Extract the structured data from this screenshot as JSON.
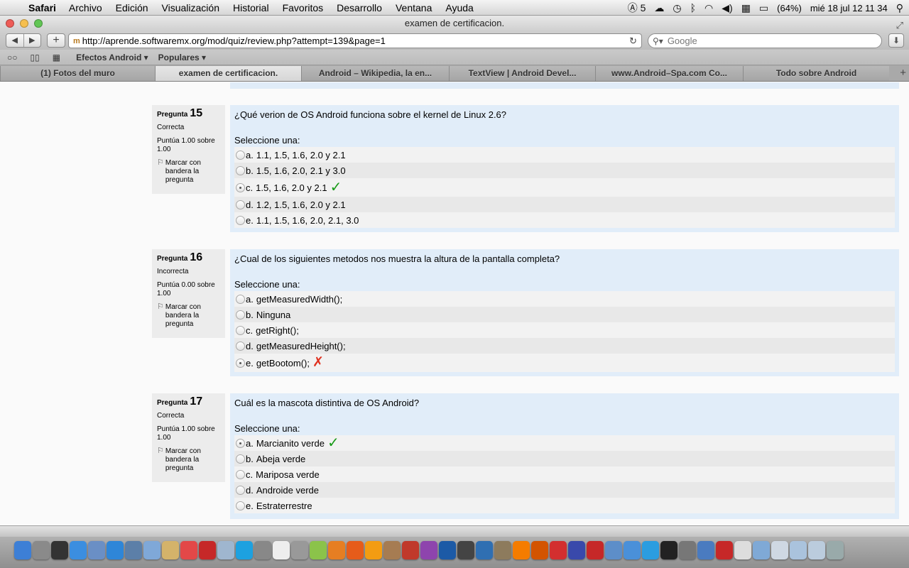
{
  "menubar": {
    "app": "Safari",
    "items": [
      "Archivo",
      "Edición",
      "Visualización",
      "Historial",
      "Favoritos",
      "Desarrollo",
      "Ventana",
      "Ayuda"
    ],
    "adobe_count": "5",
    "battery": "(64%)",
    "clock": "mié 18 jul  12 11 34"
  },
  "window": {
    "title": "examen de certificacion."
  },
  "toolbar": {
    "url": "http://aprende.softwaremx.org/mod/quiz/review.php?attempt=139&page=1",
    "search_placeholder": "Google"
  },
  "bookmarks": [
    "Efectos Android ▾",
    "Populares ▾"
  ],
  "tabs": [
    "(1) Fotos del muro",
    "examen de certificacion.",
    "Android – Wikipedia, la en...",
    "TextView | Android Devel...",
    "www.Android–Spa.com Co...",
    "Todo sobre Android"
  ],
  "questions": [
    {
      "label": "Pregunta",
      "number": "15",
      "state": "Correcta",
      "grade": "Puntúa 1.00 sobre 1.00",
      "flag": "Marcar con bandera la pregunta",
      "text": "¿Qué verion de OS Android funciona sobre el kernel de Linux 2.6?",
      "prompt": "Seleccione una:",
      "answers": [
        {
          "letter": "a.",
          "text": "1.1, 1.5, 1.6, 2.0 y 2.1"
        },
        {
          "letter": "b.",
          "text": "1.5, 1.6, 2.0, 2.1 y 3.0"
        },
        {
          "letter": "c.",
          "text": "1.5, 1.6, 2.0 y 2.1"
        },
        {
          "letter": "d.",
          "text": "1.2, 1.5, 1.6, 2.0 y 2.1"
        },
        {
          "letter": "e.",
          "text": "1.1, 1.5, 1.6, 2.0, 2.1, 3.0"
        }
      ]
    },
    {
      "label": "Pregunta",
      "number": "16",
      "state": "Incorrecta",
      "grade": "Puntúa 0.00 sobre 1.00",
      "flag": "Marcar con bandera la pregunta",
      "text": "¿Cual de los siguientes metodos nos muestra la altura de la pantalla completa?",
      "prompt": "Seleccione una:",
      "answers": [
        {
          "letter": "a.",
          "text": "getMeasuredWidth();"
        },
        {
          "letter": "b.",
          "text": "Ninguna"
        },
        {
          "letter": "c.",
          "text": "getRight();"
        },
        {
          "letter": "d.",
          "text": "getMeasuredHeight();"
        },
        {
          "letter": "e.",
          "text": "getBootom();"
        }
      ]
    },
    {
      "label": "Pregunta",
      "number": "17",
      "state": "Correcta",
      "grade": "Puntúa 1.00 sobre 1.00",
      "flag": "Marcar con bandera la pregunta",
      "text": "Cuál es la mascota distintiva de OS Android?",
      "prompt": "Seleccione una:",
      "answers": [
        {
          "letter": "a.",
          "text": "Marcianito verde"
        },
        {
          "letter": "b.",
          "text": "Abeja verde"
        },
        {
          "letter": "c.",
          "text": "Mariposa verde"
        },
        {
          "letter": "d.",
          "text": "Androide verde"
        },
        {
          "letter": "e.",
          "text": "Estraterrestre"
        }
      ]
    }
  ],
  "marks": {
    "correct": "✓",
    "incorrect": "✗"
  },
  "dock": [
    {
      "icon": "finder-icon",
      "color": "#3d7fd6"
    },
    {
      "icon": "launchpad-icon",
      "color": "#8a8a8a"
    },
    {
      "icon": "dashboard-icon",
      "color": "#333"
    },
    {
      "icon": "appstore-icon",
      "color": "#3b8ee0"
    },
    {
      "icon": "preview-icon",
      "color": "#6a8fc5"
    },
    {
      "icon": "safari-icon",
      "color": "#2e86d8"
    },
    {
      "icon": "xcode-icon",
      "color": "#5c7fa8"
    },
    {
      "icon": "mail-icon",
      "color": "#7fa8d8"
    },
    {
      "icon": "notes-icon",
      "color": "#d4b36a"
    },
    {
      "icon": "calendar-icon",
      "color": "#e34848"
    },
    {
      "icon": "filezilla-icon",
      "color": "#c62828"
    },
    {
      "icon": "box-icon",
      "color": "#9fb6cf"
    },
    {
      "icon": "skype-icon",
      "color": "#1da1e0"
    },
    {
      "icon": "utility-icon",
      "color": "#888"
    },
    {
      "icon": "textedit-icon",
      "color": "#eee"
    },
    {
      "icon": "photo-icon",
      "color": "#999"
    },
    {
      "icon": "android-icon",
      "color": "#8bc34a"
    },
    {
      "icon": "blender-icon",
      "color": "#e67e22"
    },
    {
      "icon": "firefox-icon",
      "color": "#e65c1a"
    },
    {
      "icon": "illustrator-icon",
      "color": "#f39c12"
    },
    {
      "icon": "character-icon",
      "color": "#a67c52"
    },
    {
      "icon": "stamp-icon",
      "color": "#c0392b"
    },
    {
      "icon": "app-icon",
      "color": "#8e44ad"
    },
    {
      "icon": "photoshop-icon",
      "color": "#1c5aa6"
    },
    {
      "icon": "unity-icon",
      "color": "#444"
    },
    {
      "icon": "virtualbox-icon",
      "color": "#2f6fb2"
    },
    {
      "icon": "gimp-icon",
      "color": "#8d7b5d"
    },
    {
      "icon": "vlc-icon",
      "color": "#f57c00"
    },
    {
      "icon": "game-icon",
      "color": "#d35400"
    },
    {
      "icon": "angrybird-icon",
      "color": "#d32f2f"
    },
    {
      "icon": "globe-icon",
      "color": "#3949ab"
    },
    {
      "icon": "star-icon",
      "color": "#c62828"
    },
    {
      "icon": "activity-icon",
      "color": "#5d8ec9"
    },
    {
      "icon": "itunes-icon",
      "color": "#4a90d9"
    },
    {
      "icon": "twitter-icon",
      "color": "#2b9de0"
    },
    {
      "icon": "terminal-icon",
      "color": "#222"
    },
    {
      "icon": "system-prefs-icon",
      "color": "#777"
    },
    {
      "icon": "pencil-icon",
      "color": "#4a7bc0"
    },
    {
      "icon": "flash-icon",
      "color": "#c62828"
    },
    {
      "icon": "document-icon",
      "color": "#ddd"
    },
    {
      "icon": "folder-icon",
      "color": "#7fa9d6"
    },
    {
      "icon": "mail2-icon",
      "color": "#cfd8e3"
    },
    {
      "icon": "folder2-icon",
      "color": "#aac3dd"
    },
    {
      "icon": "downloads-icon",
      "color": "#bcd"
    },
    {
      "icon": "trash-icon",
      "color": "#9aa"
    }
  ]
}
